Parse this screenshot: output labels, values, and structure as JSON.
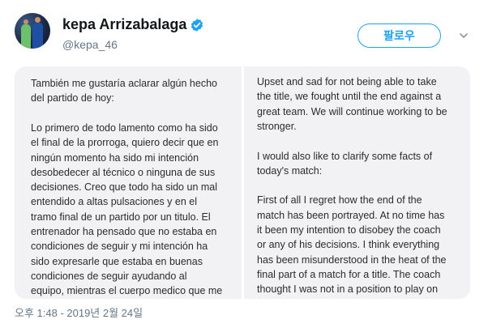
{
  "tweet": {
    "display_name": "kepa Arrizabalaga",
    "handle": "@kepa_46",
    "follow_label": "팔로우",
    "timestamp": "오후 1:48 - 2019년 2월 24일"
  },
  "icons": {
    "verified": "verified-badge-icon",
    "menu": "chevron-down-icon"
  },
  "colors": {
    "accent": "#1da1f2",
    "secondary_text": "#657786"
  },
  "media": {
    "left_lines": [
      "También me gustaría aclarar algún hecho",
      "del partido de hoy:",
      "",
      "Lo primero de todo lamento como ha sido",
      "el final de la prorroga, quiero decir que en",
      "ningún momento ha sido mi intención",
      "desobedecer al técnico o ninguna de sus",
      "decisiones. Creo que todo ha sido un mal",
      "entendido a altas pulsaciones y en el",
      "tramo final de un partido por un titulo. El",
      "entrenador ha pensado que no estaba en",
      "condiciones de seguir y mi intención ha",
      "sido expresarle que estaba en buenas",
      "condiciones de seguir ayudando al",
      "equipo, mientras el cuerpo medico que me"
    ],
    "right_lines": [
      "Upset and sad for not being able to take",
      "the title, we fought until the end against a",
      "great team. We will continue working to be",
      "stronger.",
      "",
      "I would also like to clarify some facts of",
      "today's match:",
      "",
      "First of all I regret how the end of the",
      "match has been portrayed. At no time has",
      "it been my intention to disobey the coach",
      "or any of his decisions. I think everything",
      "has been misunderstood in the heat of the",
      "final part of a match for a title. The coach",
      "thought I was not in a position to play on"
    ]
  }
}
